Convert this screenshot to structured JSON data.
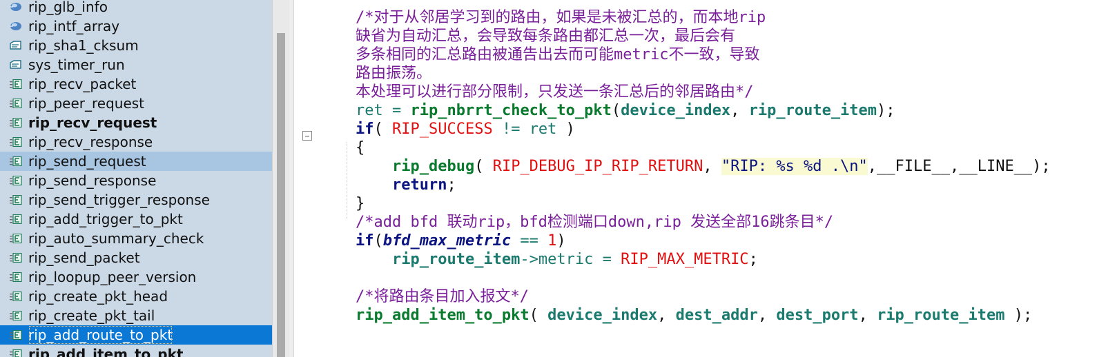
{
  "sidebar": {
    "items": [
      {
        "label": "rip_glb_info",
        "icon": "global-variable-icon",
        "style": "normal"
      },
      {
        "label": "rip_intf_array",
        "icon": "global-variable-icon",
        "style": "normal"
      },
      {
        "label": "rip_sha1_cksum",
        "icon": "prototype-icon",
        "style": "normal"
      },
      {
        "label": "sys_timer_run",
        "icon": "prototype-icon",
        "style": "normal"
      },
      {
        "label": "rip_recv_packet",
        "icon": "function-icon",
        "style": "normal"
      },
      {
        "label": "rip_peer_request",
        "icon": "function-icon",
        "style": "normal"
      },
      {
        "label": "rip_recv_request",
        "icon": "function-icon",
        "style": "bold"
      },
      {
        "label": "rip_recv_response",
        "icon": "function-icon",
        "style": "normal"
      },
      {
        "label": "rip_send_request",
        "icon": "function-icon",
        "style": "highlight"
      },
      {
        "label": "rip_send_response",
        "icon": "function-icon",
        "style": "normal"
      },
      {
        "label": "rip_send_trigger_response",
        "icon": "function-icon",
        "style": "normal"
      },
      {
        "label": "rip_add_trigger_to_pkt",
        "icon": "function-icon",
        "style": "normal"
      },
      {
        "label": "rip_auto_summary_check",
        "icon": "function-icon",
        "style": "normal"
      },
      {
        "label": "rip_send_packet",
        "icon": "function-icon",
        "style": "normal"
      },
      {
        "label": "rip_loopup_peer_version",
        "icon": "function-icon",
        "style": "normal"
      },
      {
        "label": "rip_create_pkt_head",
        "icon": "function-icon",
        "style": "normal"
      },
      {
        "label": "rip_create_pkt_tail",
        "icon": "function-icon",
        "style": "normal"
      },
      {
        "label": "rip_add_route_to_pkt",
        "icon": "function-icon",
        "style": "selected"
      },
      {
        "label": "rip_add_item_to_pkt",
        "icon": "function-icon",
        "style": "bold"
      }
    ]
  },
  "editor": {
    "lines": [
      [
        {
          "t": "/*对于从邻居学习到的路由，如果是未被汇总的，而本地rip",
          "c": "comment"
        }
      ],
      [
        {
          "t": "缺省为自动汇总，会导致每条路由都汇总一次，最后会有",
          "c": "comment"
        }
      ],
      [
        {
          "t": "多条相同的汇总路由被通告出去而可能metric不一致，导致",
          "c": "comment"
        }
      ],
      [
        {
          "t": "路由振荡。",
          "c": "comment"
        }
      ],
      [
        {
          "t": "本处理可以进行部分限制，只发送一条汇总后的邻居路由*/",
          "c": "comment"
        }
      ],
      [
        {
          "t": "ret",
          "c": "id"
        },
        {
          "t": " = ",
          "c": "op"
        },
        {
          "t": "rip_nbrrt_check_to_pkt",
          "c": "fn"
        },
        {
          "t": "(",
          "c": "plain"
        },
        {
          "t": "device_index",
          "c": "idb"
        },
        {
          "t": ", ",
          "c": "plain"
        },
        {
          "t": "rip_route_item",
          "c": "idb"
        },
        {
          "t": ");",
          "c": "plain"
        }
      ],
      [
        {
          "t": "if",
          "c": "kw"
        },
        {
          "t": "( ",
          "c": "plain"
        },
        {
          "t": "RIP_SUCCESS",
          "c": "macro"
        },
        {
          "t": " != ",
          "c": "op"
        },
        {
          "t": "ret",
          "c": "id"
        },
        {
          "t": " )",
          "c": "plain"
        }
      ],
      [
        {
          "t": "{",
          "c": "plain"
        }
      ],
      [
        {
          "t": "    ",
          "c": "plain"
        },
        {
          "t": "rip_debug",
          "c": "fn"
        },
        {
          "t": "( ",
          "c": "plain"
        },
        {
          "t": "RIP_DEBUG_IP_RIP_RETURN",
          "c": "macro"
        },
        {
          "t": ", ",
          "c": "plain"
        },
        {
          "t": "\"RIP: %s %d .\\n\"",
          "c": "str"
        },
        {
          "t": ",__FILE__,__LINE__);",
          "c": "plain"
        }
      ],
      [
        {
          "t": "    ",
          "c": "plain"
        },
        {
          "t": "return",
          "c": "kw"
        },
        {
          "t": ";",
          "c": "plain"
        }
      ],
      [
        {
          "t": "}",
          "c": "plain"
        }
      ],
      [
        {
          "t": "/*add bfd 联动rip，bfd检测端口down,rip 发送全部16跳条目*/",
          "c": "comment"
        }
      ],
      [
        {
          "t": "if",
          "c": "kw"
        },
        {
          "t": "(",
          "c": "plain"
        },
        {
          "t": "bfd_max_metric",
          "c": "idit"
        },
        {
          "t": " == ",
          "c": "op"
        },
        {
          "t": "1",
          "c": "num"
        },
        {
          "t": ")",
          "c": "plain"
        }
      ],
      [
        {
          "t": "    ",
          "c": "plain"
        },
        {
          "t": "rip_route_item",
          "c": "idb"
        },
        {
          "t": "->metric = ",
          "c": "id"
        },
        {
          "t": "RIP_MAX_METRIC",
          "c": "macro"
        },
        {
          "t": ";",
          "c": "plain"
        }
      ],
      [
        {
          "t": "",
          "c": "plain"
        }
      ],
      [
        {
          "t": "/*将路由条目加入报文*/",
          "c": "comment"
        }
      ],
      [
        {
          "t": "rip_add_item_to_pkt",
          "c": "fn"
        },
        {
          "t": "( ",
          "c": "plain"
        },
        {
          "t": "device_index",
          "c": "idb"
        },
        {
          "t": ", ",
          "c": "plain"
        },
        {
          "t": "dest_addr",
          "c": "idb"
        },
        {
          "t": ", ",
          "c": "plain"
        },
        {
          "t": "dest_port",
          "c": "idb"
        },
        {
          "t": ", ",
          "c": "plain"
        },
        {
          "t": "rip_route_item",
          "c": "idb"
        },
        {
          "t": " );",
          "c": "plain"
        }
      ]
    ]
  },
  "colors": {
    "sidebar_bg": "#cbd9e7",
    "highlight": "#a8c6e2",
    "selected": "#0a78d4",
    "comment": "#7a1f9a",
    "keyword": "#0b1480",
    "function": "#0a7a2e",
    "macro": "#e01010"
  }
}
